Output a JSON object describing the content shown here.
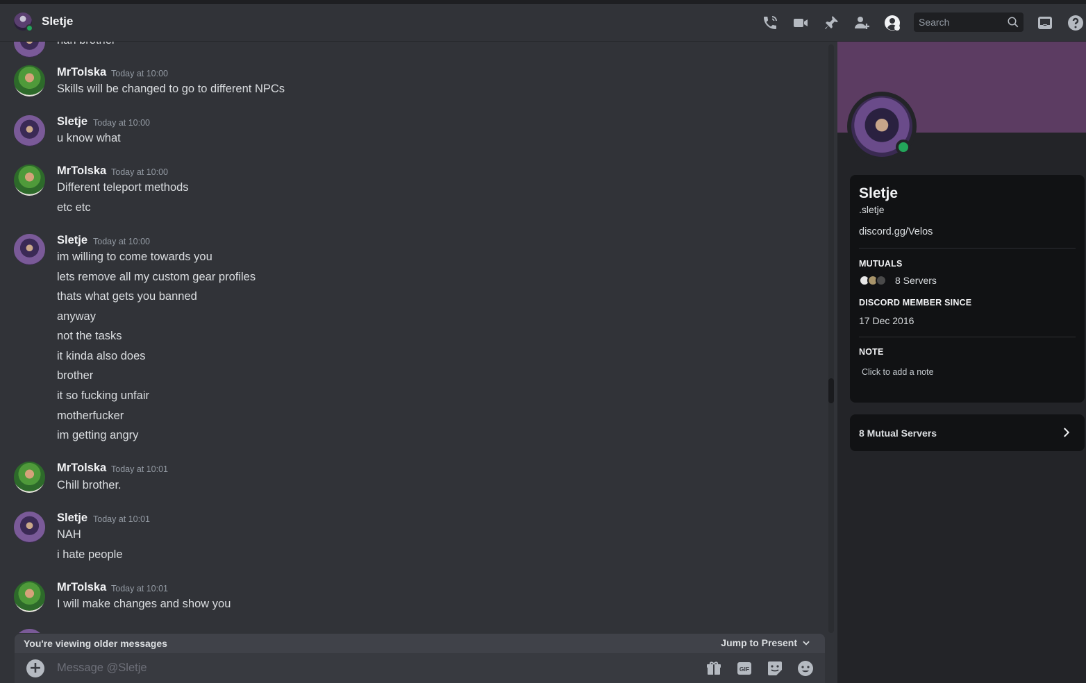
{
  "header": {
    "title": "Sletje",
    "search_placeholder": "Search",
    "icons": [
      "phone-call-icon",
      "video-call-icon",
      "pin-icon",
      "add-friend-icon",
      "user-profile-icon",
      "inbox-icon",
      "help-icon"
    ]
  },
  "chat": {
    "partial_top_line": "nah brother",
    "messages": [
      {
        "author": "MrTolska",
        "timestamp": "Today at 10:00",
        "lines": [
          "Skills will be changed to go to different NPCs"
        ]
      },
      {
        "author": "Sletje",
        "timestamp": "Today at 10:00",
        "lines": [
          "u know what"
        ]
      },
      {
        "author": "MrTolska",
        "timestamp": "Today at 10:00",
        "lines": [
          "Different teleport methods",
          "etc etc"
        ]
      },
      {
        "author": "Sletje",
        "timestamp": "Today at 10:00",
        "lines": [
          "im willing to come towards you",
          "lets remove all my custom gear profiles",
          "thats what gets you banned",
          "anyway",
          "not the tasks",
          "it kinda also does",
          "brother",
          "it so fucking unfair",
          "motherfucker",
          "im getting angry"
        ]
      },
      {
        "author": "MrTolska",
        "timestamp": "Today at 10:01",
        "lines": [
          "Chill brother."
        ]
      },
      {
        "author": "Sletje",
        "timestamp": "Today at 10:01",
        "lines": [
          "NAH",
          "i hate people"
        ]
      },
      {
        "author": "MrTolska",
        "timestamp": "Today at 10:01",
        "lines": [
          "I will make changes and show you"
        ]
      }
    ]
  },
  "older_bar": {
    "text": "You're viewing older messages",
    "jump_label": "Jump to Present"
  },
  "composer": {
    "placeholder": "Message @Sletje",
    "gif_label": "GIF"
  },
  "profile": {
    "display_name": "Sletje",
    "username": ".sletje",
    "bio": "discord.gg/Velos",
    "mutuals_heading": "MUTUALS",
    "mutuals_value": "8 Servers",
    "member_since_heading": "DISCORD MEMBER SINCE",
    "member_since_value": "17 Dec 2016",
    "note_heading": "NOTE",
    "note_placeholder": "Click to add a note",
    "mutual_servers_button": "8 Mutual Servers"
  },
  "colors": {
    "background": "#313338",
    "sidebar": "#232428",
    "banner": "#5c3c62",
    "online": "#23a55a"
  }
}
